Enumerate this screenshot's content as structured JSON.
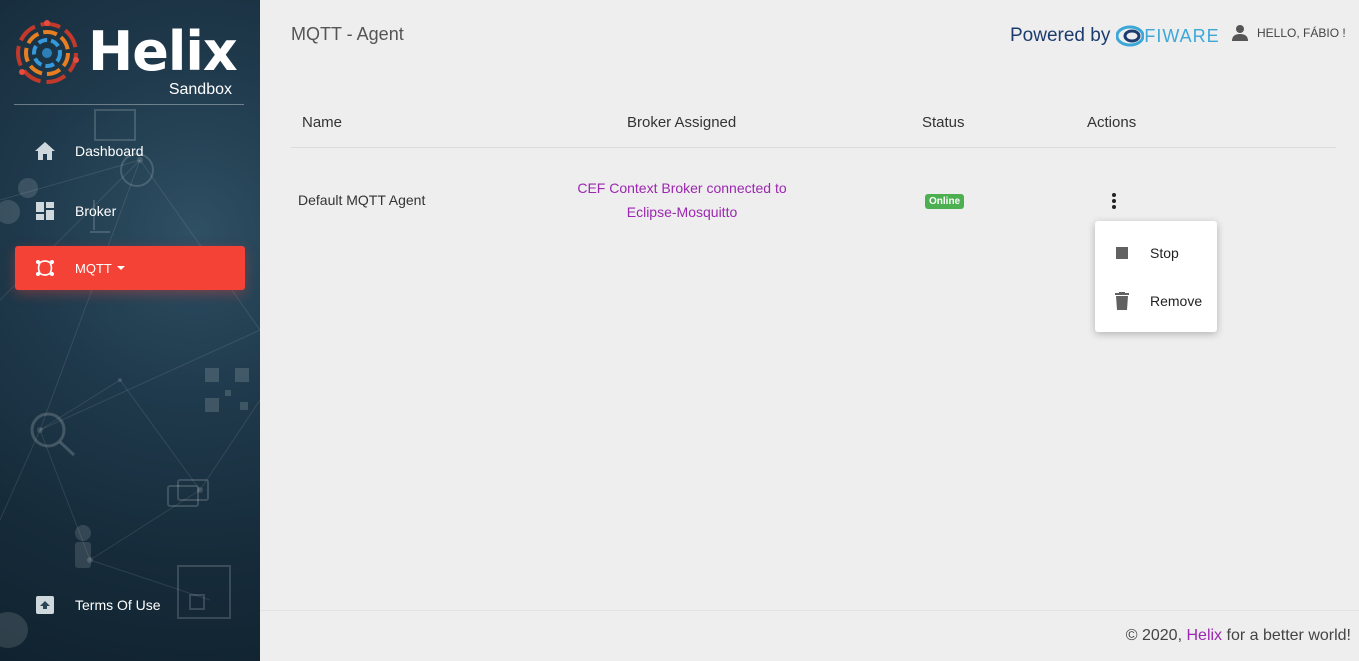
{
  "sidebar": {
    "brand": "Helix",
    "brand_sub": "Sandbox",
    "items": [
      {
        "label": "Dashboard",
        "icon": "home-icon"
      },
      {
        "label": "Broker",
        "icon": "dashboard-grid-icon"
      },
      {
        "label": "MQTT",
        "icon": "mqtt-icon",
        "active": true
      }
    ],
    "footer_item": {
      "label": "Terms Of Use",
      "icon": "archive-icon"
    }
  },
  "header": {
    "title": "MQTT - Agent",
    "powered_by": "Powered by",
    "fiware": "FIWARE",
    "greeting": "HELLO, FÁBIO !"
  },
  "table": {
    "columns": [
      "Name",
      "Broker Assigned",
      "Status",
      "Actions"
    ],
    "rows": [
      {
        "name": "Default MQTT Agent",
        "broker_line1": "CEF Context Broker connected to",
        "broker_line2": "Eclipse-Mosquitto",
        "status": "Online"
      }
    ]
  },
  "actions_menu": {
    "items": [
      {
        "label": "Stop",
        "icon": "stop-icon"
      },
      {
        "label": "Remove",
        "icon": "trash-icon"
      }
    ]
  },
  "footer": {
    "prefix": "© 2020,",
    "brand": "Helix",
    "suffix": "for a better world!"
  },
  "colors": {
    "accent": "#f44336",
    "link": "#9c27b0",
    "online": "#4caf50",
    "sidebar_bg": "#1f3a4c"
  }
}
